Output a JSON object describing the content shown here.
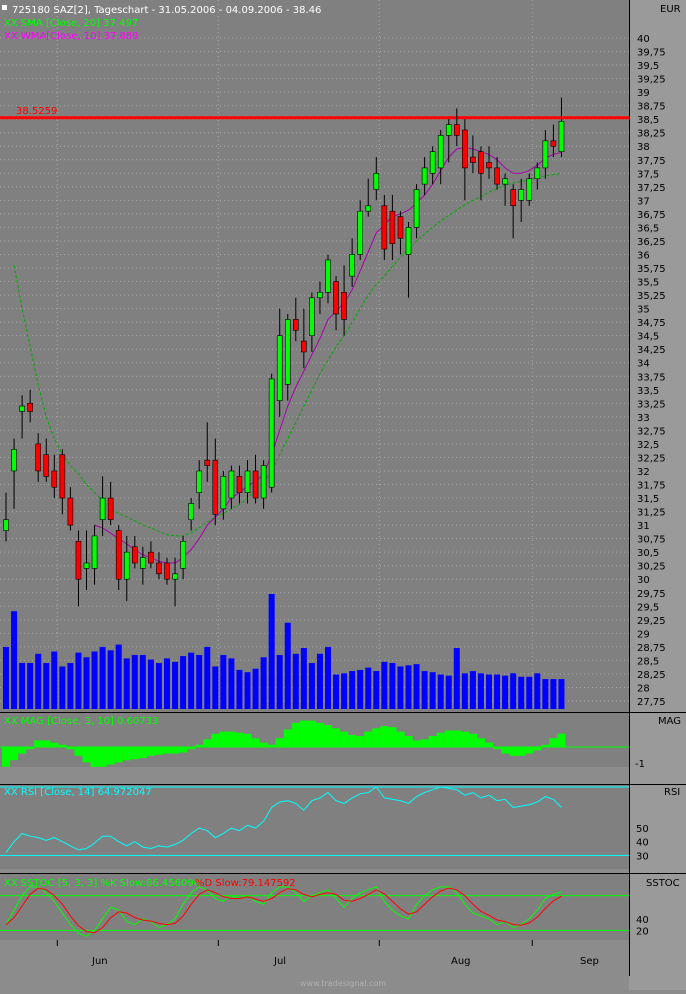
{
  "header": {
    "title": "725180  SAZ[2], Tageschart - 31.05.2006 - 04.09.2006 - 38.46",
    "sma_legend": "XX SMA [Close, 20] 37.497",
    "wma_legend": "XX WMA[Close, 10] 37.888",
    "currency": "EUR",
    "line_label": "38.5259"
  },
  "panels": {
    "mag": {
      "label": "MAG",
      "legend": "XX MAG [Close, 3, 10] 0.60733",
      "tick": "-1"
    },
    "rsi": {
      "label": "RSI",
      "legend": "XX RSI [Close, 14] 64.972047",
      "ticks": [
        "50",
        "40",
        "30"
      ]
    },
    "sstoc": {
      "label": "SSTOC",
      "legend_k": "XX SSTOC [5, 3, 3] %K Slow:86.456096",
      "legend_d": "%D Slow:79.147592",
      "ticks": [
        "40",
        "20"
      ]
    }
  },
  "x_axis": {
    "labels": [
      "Jun",
      "Jul",
      "Aug",
      "Sep"
    ]
  },
  "footer": {
    "watermark": "www.tradesignal.com"
  },
  "colors": {
    "up": "#00ff00",
    "down": "#ff0000",
    "volume": "#0000ff",
    "sma": "#00aa00",
    "wma": "#aa00aa",
    "rsi": "#00ffff",
    "hline": "#ff0000"
  },
  "chart_data": {
    "type": "candlestick",
    "ylim": [
      27.5,
      40.2
    ],
    "y_ticks": [
      27.75,
      28,
      28.25,
      28.5,
      28.75,
      29,
      29.25,
      29.5,
      29.75,
      30,
      30.25,
      30.5,
      30.75,
      31,
      31.25,
      31.5,
      31.75,
      32,
      32.25,
      32.5,
      32.75,
      33,
      33.25,
      33.5,
      33.75,
      34,
      34.25,
      34.5,
      34.75,
      35,
      35.25,
      35.5,
      35.75,
      36,
      36.25,
      36.5,
      36.75,
      37,
      37.25,
      37.5,
      37.75,
      38,
      38.25,
      38.5,
      38.75,
      39,
      39.25,
      39.5,
      39.75,
      40
    ],
    "y_tick_labels": [
      "27,75",
      "28",
      "28,25",
      "28,5",
      "28,75",
      "29",
      "29,25",
      "29,5",
      "29,75",
      "30",
      "30,25",
      "30,5",
      "30,75",
      "31",
      "31,25",
      "31,5",
      "31,75",
      "32",
      "32,25",
      "32,5",
      "32,75",
      "33",
      "33,25",
      "33,5",
      "33,75",
      "34",
      "34,25",
      "34,5",
      "34,75",
      "35",
      "35,25",
      "35,5",
      "35,75",
      "36",
      "36,25",
      "36,5",
      "36,75",
      "37",
      "37,25",
      "37,5",
      "37,75",
      "38",
      "38,25",
      "38,5",
      "38,75",
      "39",
      "39,25",
      "39,5",
      "39,75",
      "40"
    ],
    "hline": 38.5259,
    "candles": [
      {
        "o": 30.9,
        "h": 31.6,
        "l": 30.7,
        "c": 31.1
      },
      {
        "o": 32.0,
        "h": 32.6,
        "l": 31.3,
        "c": 32.4
      },
      {
        "o": 33.1,
        "h": 33.4,
        "l": 32.6,
        "c": 33.2
      },
      {
        "o": 33.25,
        "h": 33.5,
        "l": 32.9,
        "c": 33.1
      },
      {
        "o": 32.5,
        "h": 32.7,
        "l": 31.8,
        "c": 32.0
      },
      {
        "o": 32.3,
        "h": 32.6,
        "l": 31.8,
        "c": 31.9
      },
      {
        "o": 32.0,
        "h": 32.3,
        "l": 31.5,
        "c": 31.7
      },
      {
        "o": 32.3,
        "h": 32.4,
        "l": 31.2,
        "c": 31.5
      },
      {
        "o": 31.5,
        "h": 31.7,
        "l": 30.9,
        "c": 31.0
      },
      {
        "o": 30.7,
        "h": 30.9,
        "l": 29.5,
        "c": 30.0
      },
      {
        "o": 30.2,
        "h": 30.9,
        "l": 29.8,
        "c": 30.3
      },
      {
        "o": 30.2,
        "h": 31.0,
        "l": 29.9,
        "c": 30.8
      },
      {
        "o": 31.1,
        "h": 31.9,
        "l": 30.8,
        "c": 31.5
      },
      {
        "o": 31.5,
        "h": 31.8,
        "l": 31.0,
        "c": 31.1
      },
      {
        "o": 30.9,
        "h": 31.0,
        "l": 29.8,
        "c": 30.0
      },
      {
        "o": 30.0,
        "h": 30.8,
        "l": 29.6,
        "c": 30.5
      },
      {
        "o": 30.6,
        "h": 30.8,
        "l": 30.2,
        "c": 30.3
      },
      {
        "o": 30.2,
        "h": 30.6,
        "l": 29.9,
        "c": 30.4
      },
      {
        "o": 30.5,
        "h": 30.7,
        "l": 30.2,
        "c": 30.3
      },
      {
        "o": 30.3,
        "h": 30.5,
        "l": 30.0,
        "c": 30.1
      },
      {
        "o": 30.3,
        "h": 30.4,
        "l": 29.9,
        "c": 30.0
      },
      {
        "o": 30.0,
        "h": 30.4,
        "l": 29.5,
        "c": 30.1
      },
      {
        "o": 30.2,
        "h": 30.8,
        "l": 30.0,
        "c": 30.7
      },
      {
        "o": 31.1,
        "h": 31.5,
        "l": 30.9,
        "c": 31.4
      },
      {
        "o": 31.6,
        "h": 32.2,
        "l": 31.3,
        "c": 32.0
      },
      {
        "o": 32.2,
        "h": 32.9,
        "l": 31.8,
        "c": 32.1
      },
      {
        "o": 32.2,
        "h": 32.6,
        "l": 31.0,
        "c": 31.2
      },
      {
        "o": 31.3,
        "h": 32.0,
        "l": 31.1,
        "c": 31.9
      },
      {
        "o": 31.5,
        "h": 32.1,
        "l": 31.3,
        "c": 32.0
      },
      {
        "o": 31.9,
        "h": 32.1,
        "l": 31.4,
        "c": 31.6
      },
      {
        "o": 31.6,
        "h": 32.2,
        "l": 31.4,
        "c": 32.0
      },
      {
        "o": 32.0,
        "h": 32.3,
        "l": 31.4,
        "c": 31.5
      },
      {
        "o": 31.5,
        "h": 32.2,
        "l": 31.3,
        "c": 32.1
      },
      {
        "o": 31.7,
        "h": 33.8,
        "l": 31.6,
        "c": 33.7
      },
      {
        "o": 33.3,
        "h": 35.0,
        "l": 33.0,
        "c": 34.5
      },
      {
        "o": 33.6,
        "h": 34.9,
        "l": 33.3,
        "c": 34.8
      },
      {
        "o": 34.8,
        "h": 35.2,
        "l": 34.4,
        "c": 34.6
      },
      {
        "o": 34.4,
        "h": 35.0,
        "l": 33.9,
        "c": 34.2
      },
      {
        "o": 34.5,
        "h": 35.3,
        "l": 34.2,
        "c": 35.2
      },
      {
        "o": 35.2,
        "h": 35.5,
        "l": 34.9,
        "c": 35.3
      },
      {
        "o": 35.3,
        "h": 36.0,
        "l": 35.1,
        "c": 35.9
      },
      {
        "o": 35.5,
        "h": 35.6,
        "l": 34.6,
        "c": 34.9
      },
      {
        "o": 35.3,
        "h": 35.8,
        "l": 34.5,
        "c": 34.8
      },
      {
        "o": 35.6,
        "h": 36.3,
        "l": 35.4,
        "c": 36.0
      },
      {
        "o": 36.0,
        "h": 37.0,
        "l": 35.9,
        "c": 36.8
      },
      {
        "o": 36.8,
        "h": 37.4,
        "l": 36.7,
        "c": 36.9
      },
      {
        "o": 37.2,
        "h": 37.8,
        "l": 37.0,
        "c": 37.5
      },
      {
        "o": 36.9,
        "h": 37.1,
        "l": 35.9,
        "c": 36.1
      },
      {
        "o": 36.8,
        "h": 37.1,
        "l": 35.9,
        "c": 36.2
      },
      {
        "o": 36.7,
        "h": 36.8,
        "l": 36.0,
        "c": 36.3
      },
      {
        "o": 36.0,
        "h": 36.6,
        "l": 35.2,
        "c": 36.5
      },
      {
        "o": 36.5,
        "h": 37.3,
        "l": 36.3,
        "c": 37.2
      },
      {
        "o": 37.3,
        "h": 37.8,
        "l": 37.1,
        "c": 37.6
      },
      {
        "o": 37.5,
        "h": 38.0,
        "l": 37.3,
        "c": 37.9
      },
      {
        "o": 37.6,
        "h": 38.3,
        "l": 37.3,
        "c": 38.2
      },
      {
        "o": 38.2,
        "h": 38.5,
        "l": 37.7,
        "c": 38.4
      },
      {
        "o": 38.4,
        "h": 38.7,
        "l": 38.0,
        "c": 38.2
      },
      {
        "o": 38.3,
        "h": 38.5,
        "l": 37.0,
        "c": 37.6
      },
      {
        "o": 37.8,
        "h": 38.2,
        "l": 37.5,
        "c": 37.7
      },
      {
        "o": 37.9,
        "h": 38.0,
        "l": 37.0,
        "c": 37.5
      },
      {
        "o": 37.7,
        "h": 38.0,
        "l": 37.4,
        "c": 37.6
      },
      {
        "o": 37.6,
        "h": 37.8,
        "l": 37.2,
        "c": 37.3
      },
      {
        "o": 37.3,
        "h": 37.5,
        "l": 36.9,
        "c": 37.4
      },
      {
        "o": 37.2,
        "h": 37.3,
        "l": 36.3,
        "c": 36.9
      },
      {
        "o": 37.0,
        "h": 37.4,
        "l": 36.6,
        "c": 37.2
      },
      {
        "o": 37.0,
        "h": 37.5,
        "l": 36.9,
        "c": 37.4
      },
      {
        "o": 37.4,
        "h": 37.7,
        "l": 37.2,
        "c": 37.6
      },
      {
        "o": 37.6,
        "h": 38.3,
        "l": 37.4,
        "c": 38.1
      },
      {
        "o": 38.1,
        "h": 38.4,
        "l": 37.8,
        "c": 38.0
      },
      {
        "o": 37.9,
        "h": 38.9,
        "l": 37.8,
        "c": 38.46
      }
    ],
    "volume": [
      54,
      85,
      40,
      40,
      48,
      40,
      50,
      37,
      40,
      49,
      45,
      50,
      54,
      51,
      56,
      44,
      47,
      47,
      43,
      40,
      44,
      41,
      46,
      49,
      47,
      54,
      37,
      47,
      44,
      34,
      32,
      35,
      45,
      100,
      47,
      75,
      48,
      53,
      40,
      48,
      54,
      30,
      31,
      33,
      34,
      36,
      33,
      41,
      40,
      37,
      38,
      39,
      33,
      32,
      30,
      29,
      53,
      31,
      33,
      31,
      30,
      30,
      29,
      31,
      28,
      28,
      31,
      26,
      26,
      26
    ],
    "sma20": [
      null,
      35.8,
      35.0,
      34.3,
      33.6,
      33.0,
      32.6,
      32.3,
      32.1,
      31.95,
      31.75,
      31.6,
      31.45,
      31.3,
      31.22,
      31.15,
      31.08,
      31.0,
      30.95,
      30.88,
      30.82,
      30.8,
      30.8,
      30.86,
      30.95,
      31.05,
      31.15,
      31.22,
      31.3,
      31.38,
      31.5,
      31.65,
      31.8,
      32.0,
      32.3,
      32.6,
      32.9,
      33.2,
      33.5,
      33.8,
      34.05,
      34.3,
      34.5,
      34.75,
      35.0,
      35.25,
      35.45,
      35.6,
      35.78,
      35.95,
      36.1,
      36.25,
      36.38,
      36.5,
      36.62,
      36.72,
      36.82,
      36.92,
      37.0,
      37.07,
      37.15,
      37.22,
      37.28,
      37.32,
      37.35,
      37.38,
      37.42,
      37.45,
      37.48,
      37.497
    ],
    "wma10": [
      null,
      null,
      null,
      null,
      null,
      null,
      null,
      null,
      null,
      null,
      null,
      31.0,
      30.95,
      30.85,
      30.75,
      30.65,
      30.55,
      30.45,
      30.4,
      30.33,
      30.3,
      30.3,
      30.4,
      30.55,
      30.75,
      31.0,
      31.15,
      31.3,
      31.5,
      31.6,
      31.72,
      31.8,
      31.95,
      32.3,
      32.75,
      33.2,
      33.55,
      33.85,
      34.15,
      34.45,
      34.8,
      34.95,
      35.1,
      35.35,
      35.7,
      36.05,
      36.4,
      36.55,
      36.7,
      36.75,
      36.82,
      36.95,
      37.1,
      37.3,
      37.55,
      37.8,
      37.95,
      37.98,
      37.95,
      37.9,
      37.85,
      37.75,
      37.6,
      37.5,
      37.5,
      37.55,
      37.65,
      37.78,
      37.85,
      37.888
    ],
    "mag": [
      -0.9,
      -0.6,
      -0.3,
      -0.1,
      0.3,
      0.3,
      0.2,
      0.1,
      -0.1,
      -0.4,
      -0.7,
      -0.9,
      -0.9,
      -0.8,
      -0.7,
      -0.6,
      -0.55,
      -0.5,
      -0.4,
      -0.35,
      -0.3,
      -0.3,
      -0.25,
      -0.1,
      0.1,
      0.35,
      0.6,
      0.7,
      0.7,
      0.65,
      0.6,
      0.4,
      0.2,
      0.1,
      0.4,
      0.8,
      1.1,
      1.2,
      1.2,
      1.1,
      1.0,
      0.85,
      0.7,
      0.55,
      0.5,
      0.7,
      0.85,
      0.95,
      0.9,
      0.7,
      0.5,
      0.3,
      0.35,
      0.5,
      0.65,
      0.75,
      0.75,
      0.7,
      0.6,
      0.4,
      0.2,
      -0.1,
      -0.3,
      -0.4,
      -0.4,
      -0.3,
      -0.15,
      0.1,
      0.4,
      0.60733
    ],
    "rsi": [
      32,
      40,
      46,
      44,
      43,
      41,
      43,
      40,
      37,
      34,
      35,
      39,
      44,
      44,
      40,
      37,
      40,
      36,
      35,
      37,
      36,
      38,
      41,
      46,
      50,
      48,
      43,
      46,
      50,
      48,
      52,
      50,
      55,
      65,
      69,
      70,
      68,
      63,
      70,
      72,
      76,
      70,
      68,
      72,
      75,
      76,
      80,
      72,
      71,
      70,
      68,
      73,
      76,
      78,
      80,
      79,
      78,
      74,
      76,
      72,
      74,
      70,
      71,
      65,
      66,
      67,
      69,
      73,
      71,
      64.972047
    ],
    "stoch_k": [
      30,
      55,
      80,
      95,
      95,
      85,
      70,
      50,
      30,
      15,
      10,
      20,
      40,
      60,
      55,
      35,
      30,
      40,
      35,
      25,
      30,
      40,
      65,
      85,
      95,
      90,
      75,
      70,
      80,
      75,
      80,
      70,
      65,
      85,
      95,
      95,
      85,
      70,
      80,
      85,
      90,
      75,
      60,
      75,
      85,
      90,
      95,
      70,
      55,
      45,
      40,
      65,
      80,
      90,
      95,
      95,
      85,
      65,
      50,
      45,
      40,
      30,
      35,
      25,
      30,
      40,
      55,
      75,
      82,
      86.456096
    ],
    "stoch_d": [
      30,
      42,
      62,
      82,
      93,
      90,
      80,
      65,
      45,
      28,
      18,
      16,
      25,
      42,
      52,
      50,
      42,
      38,
      36,
      32,
      30,
      32,
      45,
      65,
      82,
      90,
      85,
      78,
      75,
      75,
      78,
      74,
      70,
      75,
      85,
      92,
      90,
      82,
      78,
      82,
      85,
      82,
      72,
      70,
      75,
      82,
      90,
      83,
      70,
      57,
      48,
      52,
      65,
      78,
      88,
      93,
      90,
      80,
      65,
      53,
      46,
      38,
      35,
      30,
      29,
      33,
      43,
      58,
      71,
      79.147592
    ],
    "month_tick_bars": [
      6,
      26,
      46,
      65
    ]
  }
}
